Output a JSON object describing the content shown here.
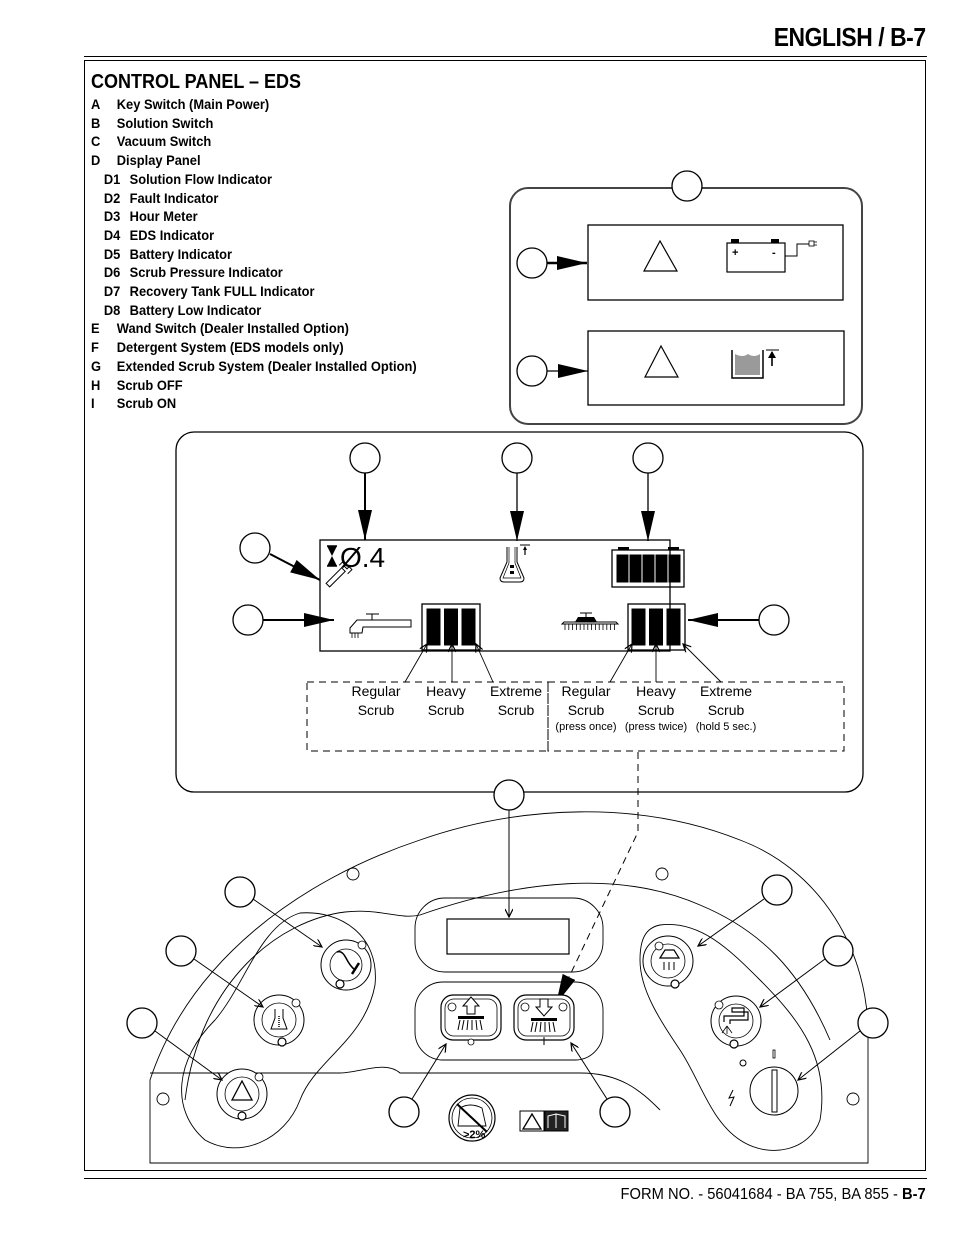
{
  "header": {
    "title": "ENGLISH / B-7"
  },
  "section": {
    "title": "CONTROL PANEL – EDS",
    "legend": [
      {
        "key": "A",
        "label": "Key Switch (Main Power)",
        "sub": false
      },
      {
        "key": "B",
        "label": "Solution Switch",
        "sub": false
      },
      {
        "key": "C",
        "label": "Vacuum Switch",
        "sub": false
      },
      {
        "key": "D",
        "label": "Display Panel",
        "sub": false
      },
      {
        "key": "D1",
        "label": "Solution Flow Indicator",
        "sub": true
      },
      {
        "key": "D2",
        "label": "Fault Indicator",
        "sub": true
      },
      {
        "key": "D3",
        "label": "Hour Meter",
        "sub": true
      },
      {
        "key": "D4",
        "label": "EDS Indicator",
        "sub": true
      },
      {
        "key": "D5",
        "label": "Battery Indicator",
        "sub": true
      },
      {
        "key": "D6",
        "label": "Scrub Pressure Indicator",
        "sub": true
      },
      {
        "key": "D7",
        "label": "Recovery Tank FULL Indicator",
        "sub": true
      },
      {
        "key": "D8",
        "label": "Battery Low Indicator",
        "sub": true
      },
      {
        "key": "E",
        "label": "Wand Switch (Dealer Installed Option)",
        "sub": false
      },
      {
        "key": "F",
        "label": "Detergent System (EDS models only)",
        "sub": false
      },
      {
        "key": "G",
        "label": "Extended Scrub System (Dealer Installed Option)",
        "sub": false
      },
      {
        "key": "H",
        "label": "Scrub OFF",
        "sub": false
      },
      {
        "key": "I",
        "label": "Scrub ON",
        "sub": false
      }
    ]
  },
  "display": {
    "hour_meter": "Ø.4",
    "battery_cells_lit": 5,
    "solution_flow_bars_lit": 3,
    "scrub_pressure_bars_lit": 3
  },
  "battery_terminals": {
    "plus": "+",
    "minus": "-"
  },
  "slope_badge": ">2%",
  "scrub_labels_left": [
    {
      "line1": "Regular",
      "line2": "Scrub"
    },
    {
      "line1": "Heavy",
      "line2": "Scrub"
    },
    {
      "line1": "Extreme",
      "line2": "Scrub"
    }
  ],
  "scrub_labels_right": [
    {
      "line1": "Regular",
      "line2": "Scrub",
      "note": "(press once)"
    },
    {
      "line1": "Heavy",
      "line2": "Scrub",
      "note": "(press twice)"
    },
    {
      "line1": "Extreme",
      "line2": "Scrub",
      "note": "(hold 5 sec.)"
    }
  ],
  "footer": {
    "form": "FORM NO. - 56041684 - BA 755, BA 855 - ",
    "page": "B-7"
  }
}
